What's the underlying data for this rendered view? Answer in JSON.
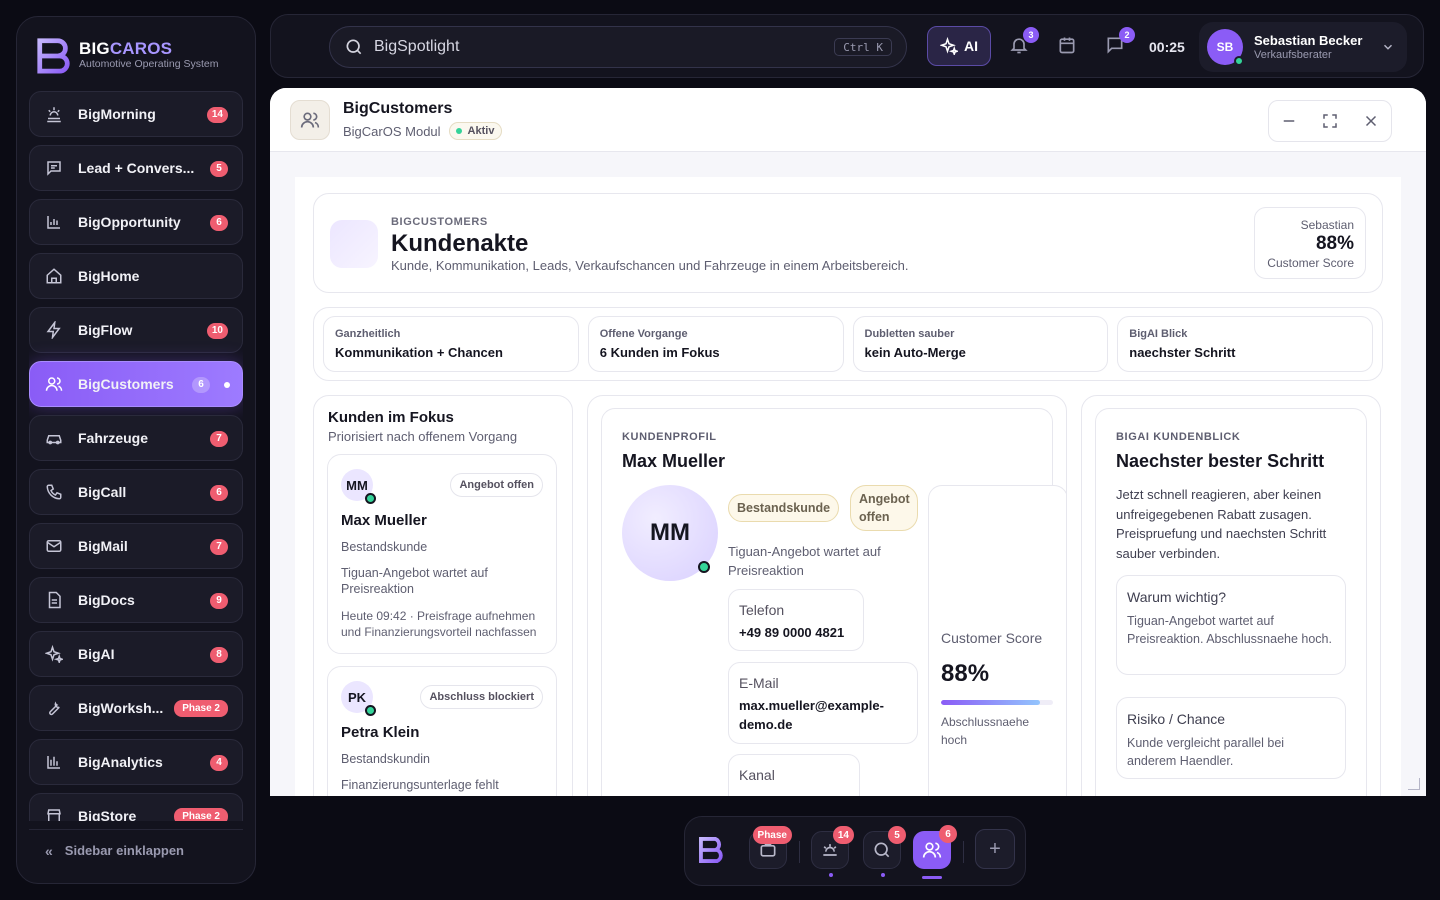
{
  "brand": {
    "name_primary": "BIG",
    "name_accent": "CAROS",
    "tagline": "Automotive Operating System",
    "accent_color": "#a896ff"
  },
  "sidebar": {
    "items": [
      {
        "label": "BigMorning",
        "icon": "sunrise-icon",
        "badge": "14"
      },
      {
        "label": "Lead + Convers...",
        "icon": "message-square-icon",
        "badge": "5"
      },
      {
        "label": "BigOpportunity",
        "icon": "bar-chart-icon",
        "badge": "6"
      },
      {
        "label": "BigHome",
        "icon": "home-icon",
        "badge": ""
      },
      {
        "label": "BigFlow",
        "icon": "lightning-icon",
        "badge": "10"
      },
      {
        "label": "BigCustomers",
        "icon": "users-icon",
        "badge": "6",
        "active": true
      },
      {
        "label": "Fahrzeuge",
        "icon": "car-icon",
        "badge": "7"
      },
      {
        "label": "BigCall",
        "icon": "phone-icon",
        "badge": "6"
      },
      {
        "label": "BigMail",
        "icon": "mail-icon",
        "badge": "7"
      },
      {
        "label": "BigDocs",
        "icon": "document-icon",
        "badge": "9"
      },
      {
        "label": "BigAI",
        "icon": "sparkles-icon",
        "badge": "8"
      },
      {
        "label": "BigWorksh...",
        "icon": "wrench-icon",
        "badge": "Phase 2"
      },
      {
        "label": "BigAnalytics",
        "icon": "analytics-icon",
        "badge": "4"
      },
      {
        "label": "BigStore",
        "icon": "store-icon",
        "badge": "Phase 2"
      }
    ],
    "collapse_label": "Sidebar einklappen",
    "active_color": "#8b5cf6",
    "badge_color": "#ef5d70"
  },
  "topbar": {
    "search_placeholder": "BigSpotlight",
    "search_shortcut": "Ctrl K",
    "ai_label": "AI",
    "notifications_count": "3",
    "messages_count": "2",
    "clock": "00:25",
    "user": {
      "initials": "SB",
      "name": "Sebastian Becker",
      "role": "Verkaufsberater"
    }
  },
  "window": {
    "title": "BigCustomers",
    "subtitle": "BigCarOS Modul",
    "status": "Aktiv"
  },
  "hero": {
    "eyebrow": "BIGCUSTOMERS",
    "title": "Kundenakte",
    "description": "Kunde, Kommunikation, Leads, Verkaufschancen und Fahrzeuge in einem Arbeitsbereich.",
    "score_name": "Sebastian",
    "score_value": "88%",
    "score_label": "Customer Score"
  },
  "kpis": [
    {
      "label": "Ganzheitlich",
      "value": "Kommunikation + Chancen"
    },
    {
      "label": "Offene Vorgange",
      "value": "6 Kunden im Fokus"
    },
    {
      "label": "Dubletten sauber",
      "value": "kein Auto-Merge"
    },
    {
      "label": "BigAI Blick",
      "value": "naechster Schritt"
    }
  ],
  "focus": {
    "title": "Kunden im Fokus",
    "subtitle": "Priorisiert nach offenem Vorgang",
    "customers": [
      {
        "initials": "MM",
        "tag": "Angebot offen",
        "name": "Max Mueller",
        "type": "Bestandskunde",
        "note": "Tiguan-Angebot wartet auf Preisreaktion",
        "meta": "Heute 09:42 · Preisfrage aufnehmen und Finanzierungsvorteil nachfassen"
      },
      {
        "initials": "PK",
        "tag": "Abschluss blockiert",
        "name": "Petra Klein",
        "type": "Bestandskundin",
        "note": "Finanzierungsunterlage fehlt",
        "meta": ""
      }
    ]
  },
  "profile": {
    "eyebrow": "KUNDENPROFIL",
    "name": "Max Mueller",
    "initials": "MM",
    "tags": [
      "Bestandskunde",
      "Angebot offen"
    ],
    "note": "Tiguan-Angebot wartet auf Preisreaktion",
    "phone_label": "Telefon",
    "phone_value": "+49 89 0000 4821",
    "email_label": "E-Mail",
    "email_value": "max.mueller@example-demo.de",
    "channel_label": "Kanal",
    "score_label": "Customer Score",
    "score_value": "88%",
    "score_fraction": 0.88,
    "score_sub": "Abschlussnaehe hoch"
  },
  "ai_panel": {
    "eyebrow": "BIGAI KUNDENBLICK",
    "title": "Naechster bester Schritt",
    "text": "Jetzt schnell reagieren, aber keinen unfreigegebenen Rabatt zusagen. Preispruefung und naechsten Schritt sauber verbinden.",
    "why_title": "Warum wichtig?",
    "why_text": "Tiguan-Angebot wartet auf Preisreaktion. Abschlussnaehe hoch.",
    "risk_title": "Risiko / Chance",
    "risk_text": "Kunde vergleicht parallel bei anderem Haendler."
  },
  "dock": {
    "workshop_badge": "Phase",
    "morning_badge": "14",
    "search_badge": "5",
    "customers_badge": "6"
  }
}
